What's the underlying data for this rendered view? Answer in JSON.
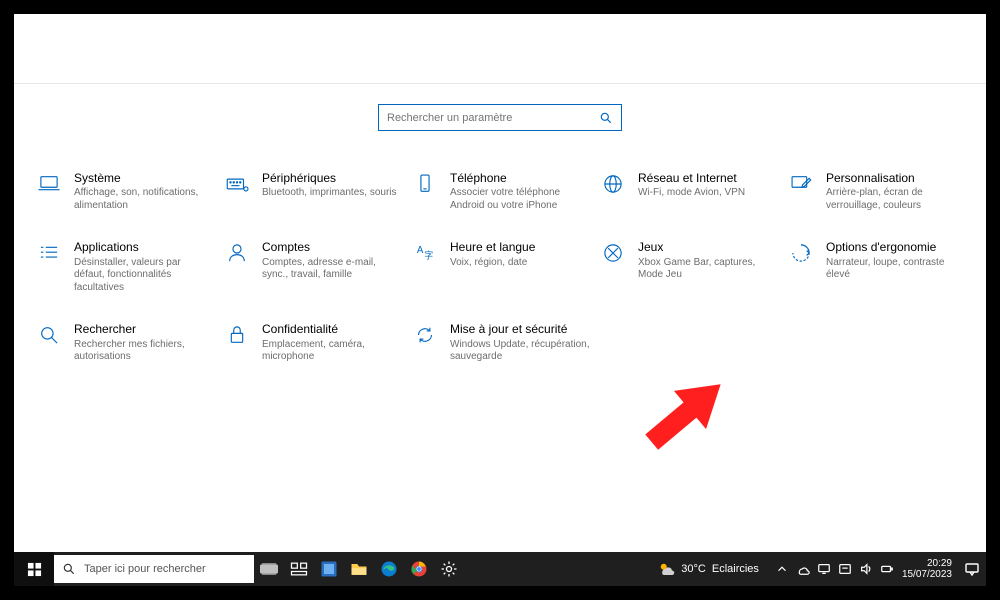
{
  "search": {
    "placeholder": "Rechercher un paramètre"
  },
  "cards": [
    {
      "title": "Système",
      "desc": "Affichage, son, notifications, alimentation"
    },
    {
      "title": "Périphériques",
      "desc": "Bluetooth, imprimantes, souris"
    },
    {
      "title": "Téléphone",
      "desc": "Associer votre téléphone Android ou votre iPhone"
    },
    {
      "title": "Réseau et Internet",
      "desc": "Wi-Fi, mode Avion, VPN"
    },
    {
      "title": "Personnalisation",
      "desc": "Arrière-plan, écran de verrouillage, couleurs"
    },
    {
      "title": "Applications",
      "desc": "Désinstaller, valeurs par défaut, fonctionnalités facultatives"
    },
    {
      "title": "Comptes",
      "desc": "Comptes, adresse e-mail, sync., travail, famille"
    },
    {
      "title": "Heure et langue",
      "desc": "Voix, région, date"
    },
    {
      "title": "Jeux",
      "desc": "Xbox Game Bar, captures, Mode Jeu"
    },
    {
      "title": "Options d'ergonomie",
      "desc": "Narrateur, loupe, contraste élevé"
    },
    {
      "title": "Rechercher",
      "desc": "Rechercher mes fichiers, autorisations"
    },
    {
      "title": "Confidentialité",
      "desc": "Emplacement, caméra, microphone"
    },
    {
      "title": "Mise à jour et sécurité",
      "desc": "Windows Update, récupération, sauvegarde"
    }
  ],
  "taskbar": {
    "search_placeholder": "Taper ici pour rechercher",
    "weather_temp": "30°C",
    "weather_desc": "Eclaircies",
    "time": "20:29",
    "date": "15/07/2023"
  }
}
